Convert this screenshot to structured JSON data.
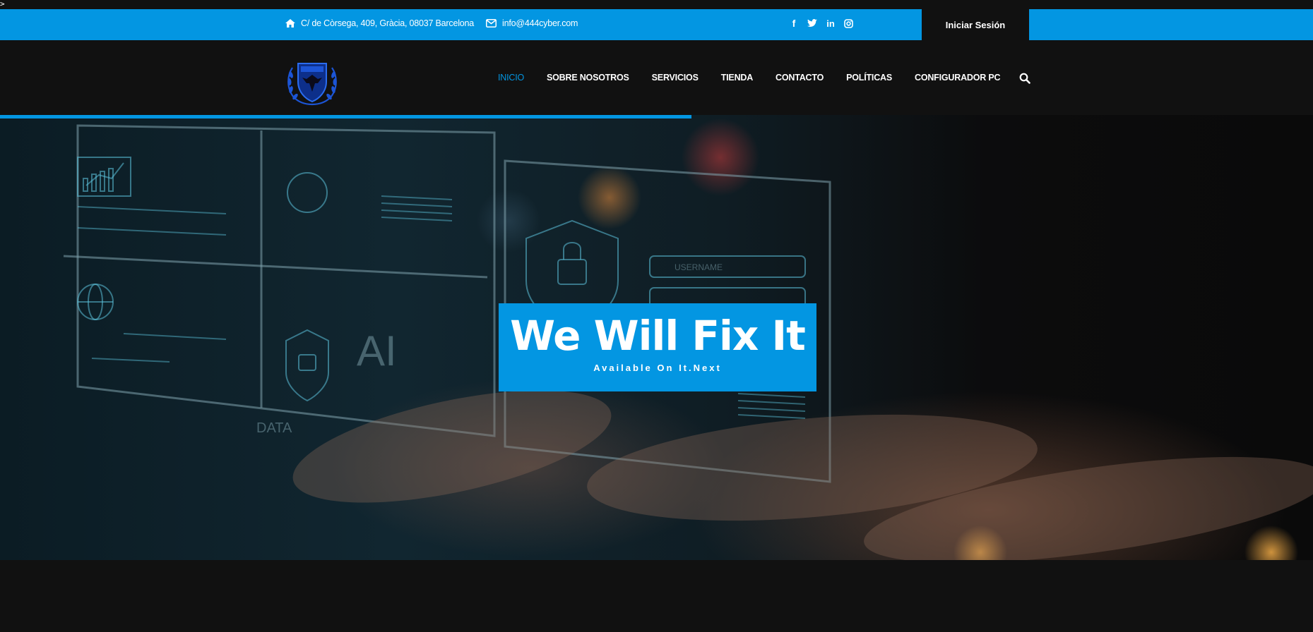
{
  "stray_text": ">",
  "topbar": {
    "address": "C/ de Còrsega, 409, Gràcia, 08037 Barcelona",
    "email": "info@444cyber.com",
    "socials": [
      {
        "name": "facebook-icon",
        "glyph": "f"
      },
      {
        "name": "twitter-icon",
        "glyph": "🐦"
      },
      {
        "name": "linkedin-icon",
        "glyph": "in"
      },
      {
        "name": "instagram-icon",
        "glyph": "◎"
      }
    ],
    "login_label": "Iniciar Sesión"
  },
  "nav": {
    "items": [
      {
        "label": "INICIO",
        "active": true
      },
      {
        "label": "SOBRE NOSOTROS",
        "active": false
      },
      {
        "label": "SERVICIOS",
        "active": false
      },
      {
        "label": "TIENDA",
        "active": false
      },
      {
        "label": "CONTACTO",
        "active": false
      },
      {
        "label": "POLÍTICAS",
        "active": false
      },
      {
        "label": "CONFIGURADOR PC",
        "active": false
      }
    ]
  },
  "hero": {
    "title": "We Will Fix It",
    "subtitle": "Available On It.Next",
    "image_text": {
      "username": "USERNAME",
      "ai": "AI",
      "data": "DATA"
    }
  },
  "colors": {
    "accent": "#0396e2",
    "dark": "#111111",
    "logo_blue": "#1c55d6"
  }
}
